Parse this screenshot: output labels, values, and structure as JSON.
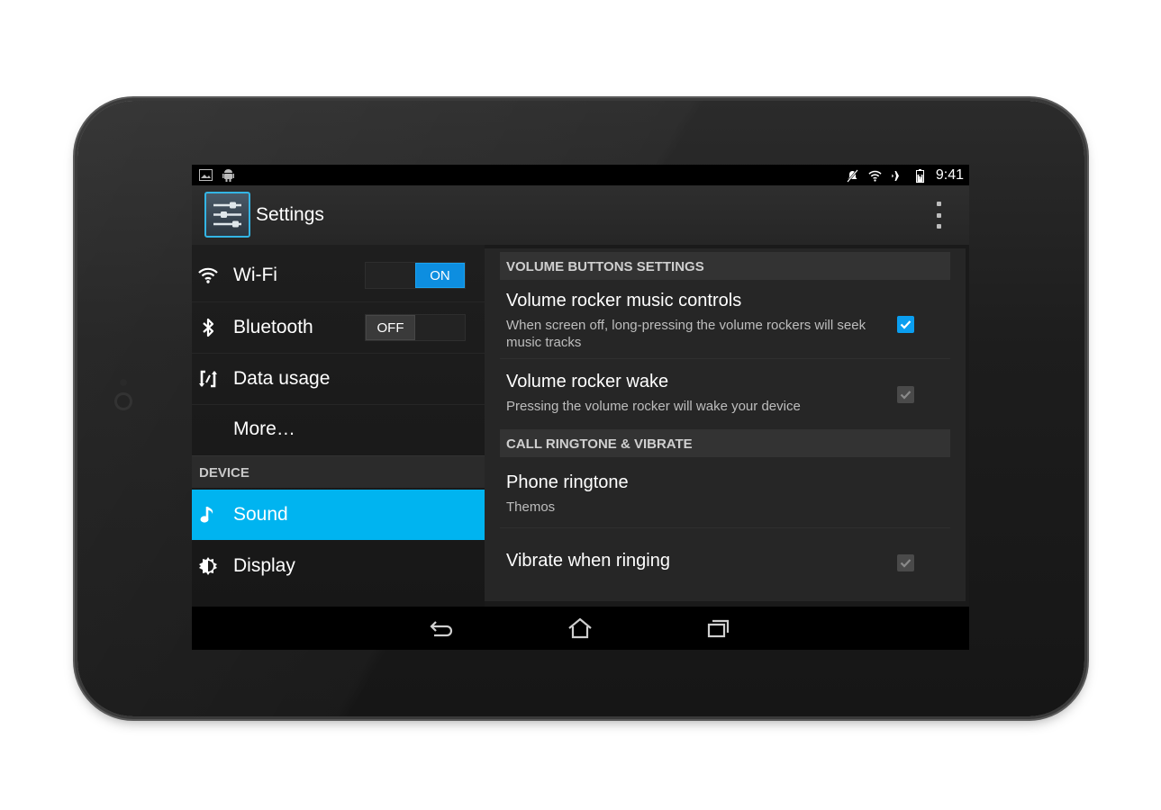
{
  "status_bar": {
    "left_icons": [
      "gallery-icon",
      "android-icon"
    ],
    "right_icons": [
      "notifications-off-icon",
      "wifi-icon",
      "airplane-icon",
      "battery-charging-icon"
    ],
    "time": "9:41"
  },
  "action_bar": {
    "title": "Settings",
    "app_icon": "settings-icon",
    "overflow_icon": "overflow-menu-icon"
  },
  "left_pane": {
    "items": [
      {
        "label": "Wi-Fi",
        "icon": "wifi-icon",
        "toggle": {
          "on_label": "ON",
          "off_label": "",
          "state": "on"
        }
      },
      {
        "label": "Bluetooth",
        "icon": "bluetooth-icon",
        "toggle": {
          "on_label": "",
          "off_label": "OFF",
          "state": "off"
        }
      },
      {
        "label": "Data usage",
        "icon": "data-usage-icon"
      },
      {
        "label": "More…",
        "icon": ""
      }
    ],
    "device_header": "DEVICE",
    "device_items": [
      {
        "label": "Sound",
        "icon": "music-note-icon",
        "active": true
      },
      {
        "label": "Display",
        "icon": "display-gear-icon",
        "active": false
      }
    ]
  },
  "right_pane": {
    "sections": [
      {
        "header": "VOLUME BUTTONS SETTINGS"
      },
      {
        "header": "CALL RINGTONE & VIBRATE"
      }
    ],
    "preferences": [
      {
        "title": "Volume rocker music controls",
        "summary": "When screen off, long-pressing the volume rockers will seek music tracks",
        "checkbox": "checked"
      },
      {
        "title": "Volume rocker wake",
        "summary": "Pressing the volume rocker will wake your device",
        "checkbox": "disabled"
      },
      {
        "title": "Phone ringtone",
        "summary": "Themos"
      },
      {
        "title": "Vibrate when ringing",
        "summary": "",
        "checkbox": "disabled"
      }
    ]
  },
  "nav_bar": {
    "buttons": [
      "back-icon",
      "home-icon",
      "recent-apps-icon"
    ]
  },
  "colors": {
    "accent": "#00b4f0",
    "toggle_on": "#0d8ee0",
    "checkbox_checked": "#0a9ef0"
  }
}
